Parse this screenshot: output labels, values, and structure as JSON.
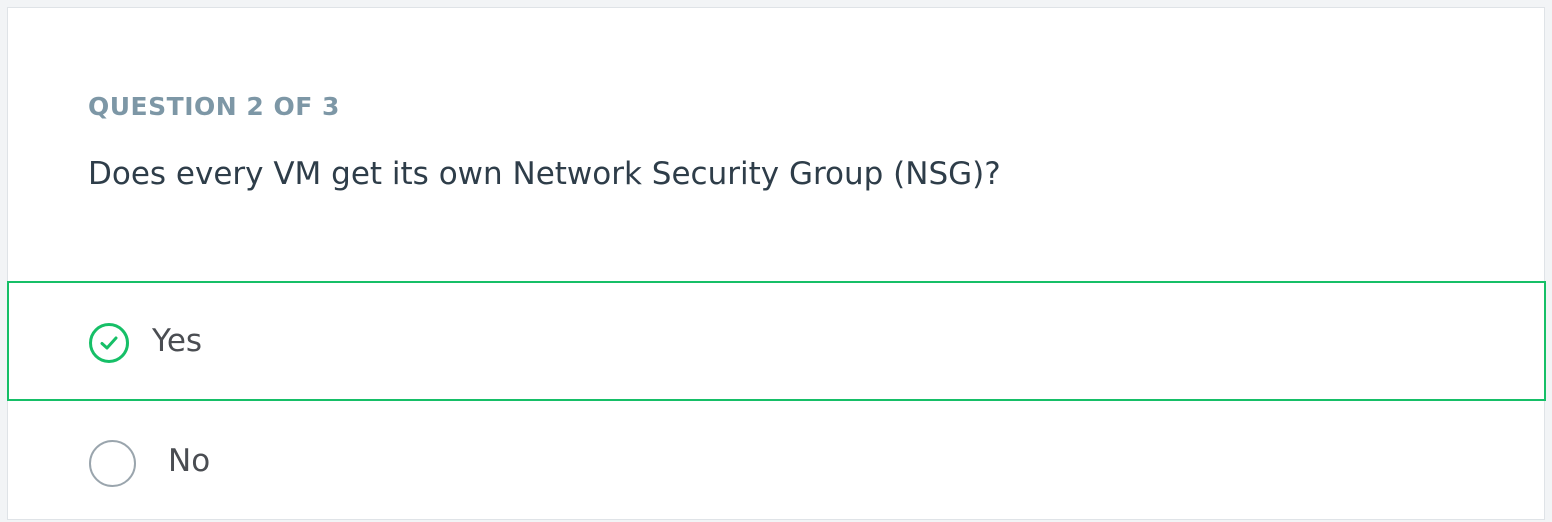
{
  "quiz": {
    "question_header": "QUESTION 2 OF 3",
    "question_text": "Does every VM get its own Network Security Group (NSG)?",
    "options": [
      {
        "label": "Yes",
        "selected": true,
        "icon": "check-circle-icon"
      },
      {
        "label": "No",
        "selected": false,
        "icon": "empty-radio-icon"
      }
    ]
  },
  "colors": {
    "selected_accent": "#16bf67",
    "header_text": "#7d97a6",
    "body_text": "#2e3d49",
    "unselected_radio": "#9aa5ad"
  }
}
